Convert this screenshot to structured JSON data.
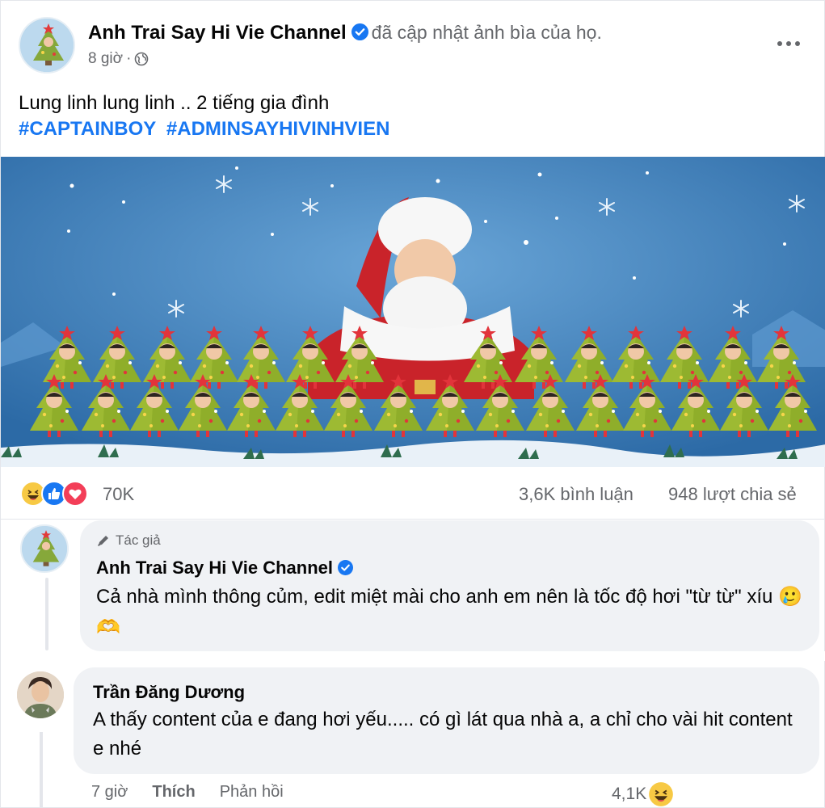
{
  "post": {
    "author": "Anh Trai Say Hi Vie Channel",
    "action": "đã cập nhật ảnh bìa của họ.",
    "time": "8 giờ",
    "caption": "Lung linh lung linh .. 2 tiếng gia đình",
    "hashtags": [
      "#CAPTAINBOY",
      "#ADMINSAYHIVINHVIEN"
    ],
    "reactions_count": "70K",
    "reaction_icons": [
      "haha-icon",
      "like-icon",
      "love-icon"
    ],
    "comments_count": "3,6K bình luận",
    "shares_count": "948 lượt chia sẻ"
  },
  "comments": [
    {
      "badge": "Tác giả",
      "name": "Anh Trai Say Hi Vie Channel",
      "text": "Cả nhà mình thông củm, edit miệt mài cho anh em nên là tốc độ hơi \"từ từ\" xíu 🥲🫶"
    },
    {
      "name": "Trần Đăng Dương",
      "text": "A thấy content của e đang hơi yếu..... có gì lát qua nhà a, a chỉ cho vài hit content e nhé",
      "time": "7 giờ",
      "like_label": "Thích",
      "reply_label": "Phản hồi",
      "reactions_count": "4,1K"
    }
  ],
  "colors": {
    "link": "#1877f2",
    "secondary_text": "#65676b",
    "bubble": "#f0f2f5",
    "sky": "#3f80bf",
    "tree": "#8fae2a"
  }
}
